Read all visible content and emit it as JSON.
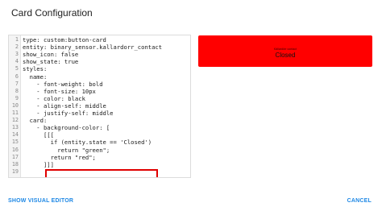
{
  "dialog": {
    "title": "Card Configuration"
  },
  "editor": {
    "lines": [
      {
        "num": "1",
        "text": "type: custom:button-card"
      },
      {
        "num": "2",
        "text": "entity: binary_sensor.kallardorr_contact"
      },
      {
        "num": "3",
        "text": "show_icon: false"
      },
      {
        "num": "4",
        "text": "show_state: true"
      },
      {
        "num": "5",
        "text": "styles:"
      },
      {
        "num": "6",
        "text": "  name:"
      },
      {
        "num": "7",
        "text": "    - font-weight: bold"
      },
      {
        "num": "8",
        "text": "    - font-size: 10px"
      },
      {
        "num": "9",
        "text": "    - color: black"
      },
      {
        "num": "10",
        "text": "    - align-self: middle"
      },
      {
        "num": "11",
        "text": "    - justify-self: middle"
      },
      {
        "num": "12",
        "text": "  card:"
      },
      {
        "num": "13",
        "text": "    - background-color: ["
      },
      {
        "num": "14",
        "text": "      [[["
      },
      {
        "num": "15",
        "text": "        if (entity.state == 'Closed')"
      },
      {
        "num": "16",
        "text": "          return \"green\";"
      },
      {
        "num": "17",
        "text": "        return \"red\";"
      },
      {
        "num": "18",
        "text": "      ]]]"
      },
      {
        "num": "19",
        "text": ""
      }
    ]
  },
  "preview": {
    "name": "Källardörr contact",
    "state": "Closed",
    "background": "#ff0000"
  },
  "footer": {
    "left_label": "SHOW VISUAL EDITOR",
    "right_label": "CANCEL"
  },
  "colors": {
    "accent": "#1e88e5",
    "highlight_border": "#e00000"
  }
}
